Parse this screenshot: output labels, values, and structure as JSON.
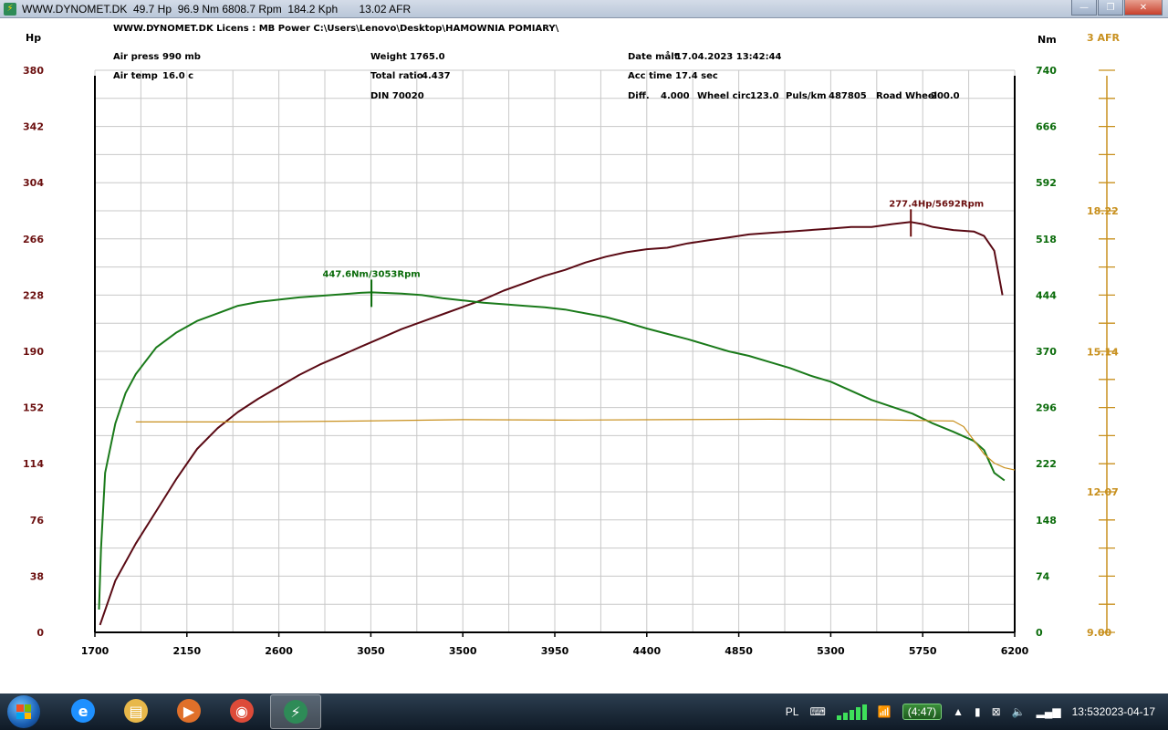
{
  "window": {
    "title": "WWW.DYNOMET.DK  49.7 Hp  96.9 Nm 6808.7 Rpm  184.2 Kph       13.02 AFR",
    "icon": "dynomet-app-icon",
    "controls": {
      "minimize": "—",
      "maximize": "❐",
      "close": "✕"
    }
  },
  "header": {
    "row1": "WWW.DYNOMET.DK   Licens :  MB Power   C:\\Users\\Lenovo\\Desktop\\HAMOWNIA POMIARY\\",
    "air_press_label": "Air press",
    "air_press_value": "990 mb",
    "air_temp_label": "Air temp",
    "air_temp_value": "16.0 c",
    "weight_label": "Weight",
    "weight_value": "1765.0",
    "ratio_label": "Total ratio",
    "ratio_value": "4.437",
    "din": "DIN 70020",
    "date_label": "Date målt",
    "date_value": "17.04.2023 13:42:44",
    "acc_label": "Acc time",
    "acc_value": "17.4 sec",
    "diff_label": "Diff.",
    "diff_value": "4.000",
    "wheel_label": "Wheel circ.",
    "wheel_value": "123.0",
    "puls_label": "Puls/km",
    "puls_value": "487805",
    "road_label": "Road Wheel",
    "road_value": "200.0"
  },
  "chart_data": {
    "type": "line",
    "xlabel": "",
    "xlim": [
      1700,
      6200
    ],
    "x_ticks": [
      1700,
      2150,
      2600,
      3050,
      3500,
      3950,
      4400,
      4850,
      5300,
      5750,
      6200
    ],
    "axes": {
      "hp": {
        "label": "Hp",
        "ylim": [
          0,
          380
        ],
        "ticks": [
          0,
          38,
          76,
          114,
          152,
          190,
          228,
          266,
          304,
          342,
          380
        ],
        "color": "#6b0f0f"
      },
      "nm": {
        "label": "Nm",
        "ylim": [
          0,
          740
        ],
        "ticks": [
          0,
          74,
          148,
          222,
          296,
          370,
          444,
          518,
          592,
          666,
          740
        ],
        "color": "#0a6b0a"
      },
      "afr": {
        "label": "3 AFR",
        "ylim": [
          9.0,
          21.29
        ],
        "ticks": [
          9.0,
          12.07,
          15.14,
          18.22
        ],
        "tick_labels": [
          "9.00",
          "12.07",
          "15.14",
          "18.22"
        ],
        "color": "#c8901e"
      }
    },
    "series": [
      {
        "name": "Hp",
        "axis": "hp",
        "color": "#5a0a14",
        "x": [
          1725,
          1800,
          1900,
          2000,
          2100,
          2200,
          2300,
          2400,
          2500,
          2600,
          2700,
          2800,
          2900,
          3000,
          3100,
          3200,
          3300,
          3400,
          3500,
          3600,
          3700,
          3800,
          3900,
          4000,
          4100,
          4200,
          4300,
          4400,
          4500,
          4600,
          4700,
          4800,
          4900,
          5000,
          5100,
          5200,
          5300,
          5400,
          5500,
          5600,
          5692,
          5750,
          5800,
          5900,
          6000,
          6050,
          6100,
          6140
        ],
        "values": [
          5,
          35,
          60,
          82,
          104,
          124,
          138,
          149,
          158,
          166,
          174,
          181,
          187,
          193,
          199,
          205,
          210,
          215,
          220,
          225,
          231,
          236,
          241,
          245,
          250,
          254,
          257,
          259,
          260,
          263,
          265,
          267,
          269,
          270,
          271,
          272,
          273,
          274,
          274,
          276,
          277.4,
          276,
          274,
          272,
          271,
          268,
          258,
          228
        ]
      },
      {
        "name": "Nm",
        "axis": "nm",
        "color": "#1a7a1a",
        "x": [
          1720,
          1730,
          1750,
          1800,
          1850,
          1900,
          2000,
          2100,
          2200,
          2300,
          2400,
          2500,
          2600,
          2700,
          2800,
          2900,
          3000,
          3053,
          3200,
          3300,
          3400,
          3500,
          3600,
          3700,
          3800,
          3900,
          4000,
          4100,
          4200,
          4300,
          4400,
          4500,
          4600,
          4700,
          4800,
          4900,
          5000,
          5100,
          5200,
          5300,
          5400,
          5500,
          5600,
          5700,
          5800,
          5900,
          6000,
          6050,
          6100,
          6150
        ],
        "values": [
          30,
          110,
          210,
          275,
          315,
          340,
          375,
          395,
          410,
          420,
          430,
          435,
          438,
          441,
          443,
          445,
          447,
          447.6,
          446,
          444,
          440,
          437,
          434,
          432,
          430,
          428,
          425,
          420,
          415,
          408,
          400,
          393,
          386,
          378,
          370,
          364,
          356,
          348,
          338,
          330,
          318,
          306,
          297,
          288,
          275,
          264,
          252,
          240,
          210,
          200
        ]
      },
      {
        "name": "AFR",
        "axis": "afr",
        "color": "#c8901e",
        "x": [
          1900,
          2500,
          3000,
          3500,
          4000,
          4500,
          5000,
          5500,
          5900,
          5950,
          6000,
          6050,
          6100,
          6150,
          6200
        ],
        "values": [
          13.6,
          13.6,
          13.62,
          13.65,
          13.64,
          13.65,
          13.66,
          13.65,
          13.62,
          13.5,
          13.2,
          12.9,
          12.7,
          12.6,
          12.55
        ]
      }
    ],
    "annotations": [
      {
        "label": "277.4Hp/5692Rpm",
        "x": 5692,
        "y": 277.4,
        "axis": "hp"
      },
      {
        "label": "447.6Nm/3053Rpm",
        "x": 3053,
        "y": 447.6,
        "axis": "nm"
      }
    ],
    "grid": true
  },
  "taskbar": {
    "apps": [
      {
        "name": "internet-explorer-icon",
        "glyph": "e",
        "color": "#1e90ff"
      },
      {
        "name": "file-explorer-icon",
        "glyph": "▤",
        "color": "#e8b84a"
      },
      {
        "name": "media-player-icon",
        "glyph": "▶",
        "color": "#e0702a"
      },
      {
        "name": "chrome-icon",
        "glyph": "◉",
        "color": "#dd4b39"
      },
      {
        "name": "dynomet-taskbar-icon",
        "glyph": "⚡",
        "color": "#2e8b57"
      }
    ],
    "language": "PL",
    "battery_time": "(4:47)",
    "clock_time": "13:53",
    "clock_date": "2023-04-17"
  }
}
